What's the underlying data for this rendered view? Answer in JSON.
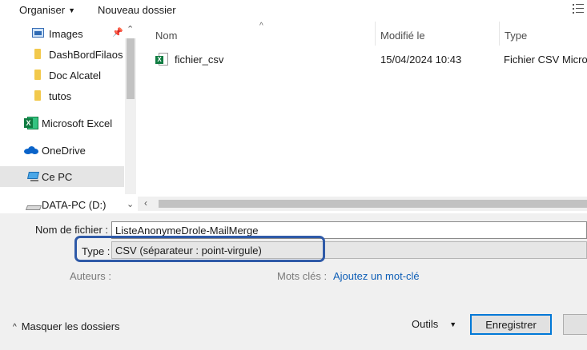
{
  "toolbar": {
    "organiser_label": "Organiser",
    "new_folder_label": "Nouveau dossier"
  },
  "nav": {
    "items": [
      {
        "label": "Images",
        "icon": "images-icon",
        "pinned": true
      },
      {
        "label": "DashBordFilaos",
        "icon": "folder-icon"
      },
      {
        "label": "Doc Alcatel",
        "icon": "folder-icon"
      },
      {
        "label": "tutos",
        "icon": "folder-icon"
      },
      {
        "label": "Microsoft Excel",
        "icon": "excel-icon"
      },
      {
        "label": "OneDrive",
        "icon": "onedrive-icon"
      },
      {
        "label": "Ce PC",
        "icon": "pc-icon",
        "selected": true
      },
      {
        "label": "DATA-PC (D:)",
        "icon": "drive-icon"
      }
    ]
  },
  "list": {
    "columns": {
      "name": "Nom",
      "modified": "Modifié le",
      "type": "Type"
    },
    "files": [
      {
        "name": "fichier_csv",
        "modified": "15/04/2024 10:43",
        "type": "Fichier CSV Micro",
        "icon": "excel-csv-file-icon"
      }
    ]
  },
  "form": {
    "filename_label": "Nom de fichier :",
    "filename_value": "ListeAnonymeDrole-MailMerge",
    "type_label": "Type :",
    "type_value": "CSV (séparateur : point-virgule)",
    "authors_label": "Auteurs :",
    "keywords_label": "Mots clés :",
    "keywords_link": "Ajoutez un mot-clé"
  },
  "footer": {
    "hide_folders_label": "Masquer les dossiers",
    "tools_label": "Outils",
    "save_label": "Enregistrer"
  },
  "colors": {
    "accent": "#0078d7",
    "highlight_border": "#2f5aa8",
    "link": "#0f5fb7",
    "selected_bg": "#e5e5e5"
  }
}
